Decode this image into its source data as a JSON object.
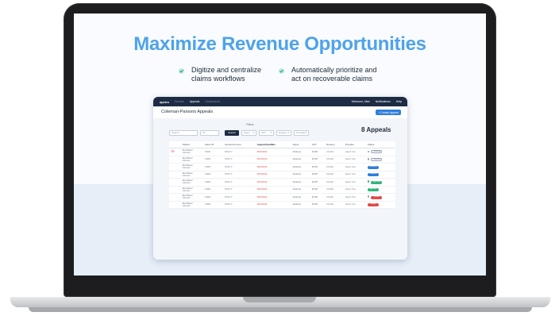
{
  "marketing": {
    "headline": "Maximize Revenue Opportunities",
    "features": [
      {
        "text": "Digitize and centralize\nclaims workflows"
      },
      {
        "text": "Automatically prioritize and\nact on recoverable claims"
      }
    ]
  },
  "app": {
    "logo": "apeiro",
    "nav": [
      "Denials",
      "Appeals",
      "Dashboards"
    ],
    "user": "Welcome, Max",
    "notifications": "Notifications",
    "help": "Help",
    "page_title": "Coleman-Parsons Appeals",
    "create_button": "+ Create Appeal",
    "filters": {
      "search_placeholder": "Search",
      "location_placeholder": "All",
      "search_button": "Search",
      "label": "Filters",
      "payer": "Payer",
      "cpt": "CPT",
      "reason": "Reason",
      "provider": "Provider"
    },
    "count": "8 Appeals",
    "columns": [
      "Patient",
      "Claim ID",
      "Denied Amount",
      "Appeal Deadline",
      "Payer",
      "CPT",
      "Reason",
      "Provider",
      "Status"
    ],
    "rows": [
      {
        "patient": "Bob Barker\nJohnson",
        "claim": "73406",
        "amount": "$742.77",
        "deadline": "08/19/2022",
        "payer": "Medicare",
        "cpt": "99798",
        "reason": "CO-110",
        "provider": "Lisa Z. Cox",
        "status": "Completed"
      },
      {
        "patient": "Bob Barker\nJohnson",
        "claim": "73406",
        "amount": "$742.77",
        "deadline": "08/19/2022",
        "payer": "Medicare",
        "cpt": "99798",
        "reason": "CO-110",
        "provider": "Lisa Z. Cox",
        "status": "Completed"
      },
      {
        "patient": "Bob Barker\nJohnson",
        "claim": "73406",
        "amount": "$742.77",
        "deadline": "08/19/2022",
        "payer": "Medicare",
        "cpt": "99798",
        "reason": "CO-110",
        "provider": "Lisa Z. Cox",
        "status": "Submitted"
      },
      {
        "patient": "Bob Barker\nJohnson",
        "claim": "73406",
        "amount": "$742.77",
        "deadline": "08/19/2022",
        "payer": "Medicare",
        "cpt": "99798",
        "reason": "CO-110",
        "provider": "Lisa Z. Cox",
        "status": "Submitted"
      },
      {
        "patient": "Bob Barker\nJohnson",
        "claim": "73406",
        "amount": "$742.77",
        "deadline": "08/19/2022",
        "payer": "Medicare",
        "cpt": "99798",
        "reason": "CO-110",
        "provider": "Lisa Z. Cox",
        "status": "Approved"
      },
      {
        "patient": "Bob Barker\nJohnson",
        "claim": "73406",
        "amount": "$742.77",
        "deadline": "08/19/2022",
        "payer": "Medicare",
        "cpt": "99798",
        "reason": "CO-110",
        "provider": "Lisa Z. Cox",
        "status": "Approved"
      },
      {
        "patient": "Bob Barker\nJohnson",
        "claim": "73406",
        "amount": "$742.77",
        "deadline": "08/19/2022",
        "payer": "Medicare",
        "cpt": "99798",
        "reason": "CO-110",
        "provider": "Lisa Z. Cox",
        "status": "Denied"
      },
      {
        "patient": "Bob Barker\nJohnson",
        "claim": "73406",
        "amount": "$742.77",
        "deadline": "08/19/2022",
        "payer": "Medicare",
        "cpt": "99798",
        "reason": "CO-110",
        "provider": "Lisa Z. Cox",
        "status": "Denied"
      }
    ],
    "status_colors": {
      "Completed": "grey",
      "Submitted": "blue",
      "Approved": "green",
      "Denied": "red"
    }
  }
}
